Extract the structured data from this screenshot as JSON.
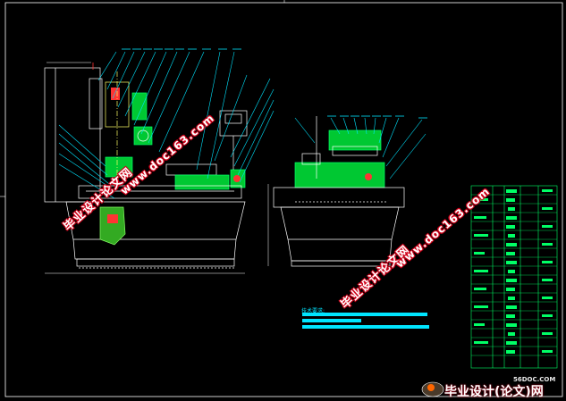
{
  "watermark": {
    "cn_text": "毕业设计论文网",
    "url_text": "www.doc163.com"
  },
  "tech_requirements": {
    "label": "技术要求:"
  },
  "footer": {
    "site_small": "56DOC.COM",
    "logo_text": "毕业设计(论文)网"
  },
  "colors": {
    "background": "#000000",
    "outline": "#ffffff",
    "leader": "#00e5ff",
    "section_fill": "#00c832",
    "accent": "#ff3333",
    "title_block": "#00ff66"
  }
}
